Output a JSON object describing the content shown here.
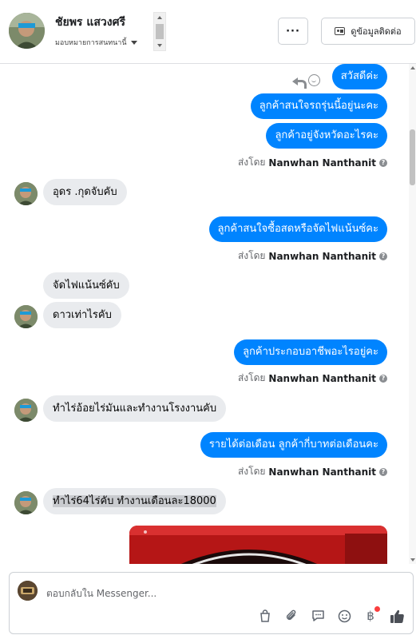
{
  "header": {
    "contact_name": "ชัยพร แสวงศรี",
    "assign_label": "มอบหมายการสนทนานี้",
    "more_label": "···",
    "contact_info_label": "ดูข้อมูลติดต่อ"
  },
  "messages": {
    "out_1": "สวัสดีค่ะ",
    "out_2": "ลูกค้าสนใจรถรุ่นนี้อยู่นะคะ",
    "out_3": "ลูกค้าอยู่จังหวัดอะไรคะ",
    "sent_prefix": "ส่งโดย",
    "sender_name": "Nanwhan Nanthanit",
    "in_1": "อุดร .กุดจับคับ",
    "out_4": "ลูกค้าสนใจซื้อสดหรือจัดไฟแน้นซ์คะ",
    "in_2": "จัดไฟแน้นซ์คับ",
    "in_3": "ดาวเท่าไรคับ",
    "out_5": "ลูกค้าประกอบอาชีพอะไรอยู่คะ",
    "in_4": "ทำไร่อ้อยไร่มันและทำงานโรงงานคับ",
    "out_6": "รายได้ต่อเดือน ลูกค้ากี่บาทต่อเดือนคะ",
    "in_5": "ทำไร่64ไร่คับ  ทำงานเดือนละ18000"
  },
  "composer": {
    "placeholder": "ตอบกลับใน Messenger..."
  },
  "icons": {
    "info": "?",
    "baht": "฿"
  },
  "colors": {
    "outgoing_bubble": "#0084ff",
    "incoming_bubble": "#e9ebee",
    "text_secondary": "#65676b"
  }
}
